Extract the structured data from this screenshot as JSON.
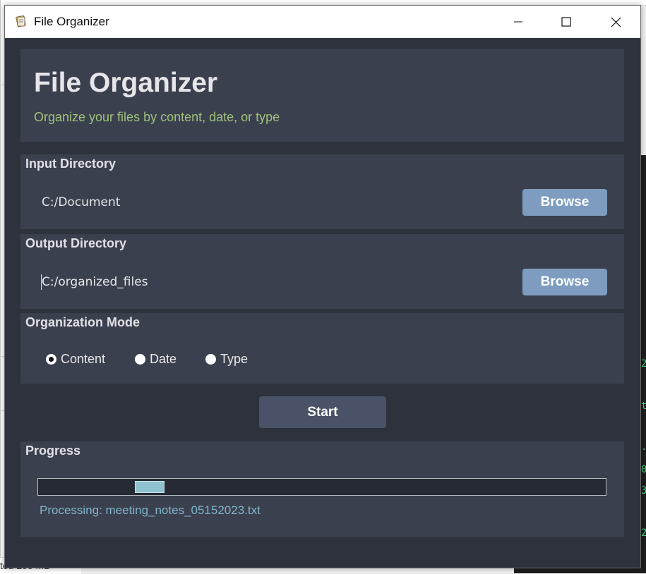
{
  "window": {
    "title": "File Organizer",
    "icons": {
      "app": "file-organizer-app-icon",
      "minimize": "minimize-icon",
      "maximize": "maximize-icon",
      "close": "close-icon"
    }
  },
  "header": {
    "title": "File Organizer",
    "subtitle": "Organize your files by content, date, or type"
  },
  "input_directory": {
    "label": "Input Directory",
    "value": "C:/Document",
    "browse_label": "Browse"
  },
  "output_directory": {
    "label": "Output Directory",
    "value": "C:/organized_files",
    "browse_label": "Browse"
  },
  "organization_mode": {
    "label": "Organization Mode",
    "options": [
      {
        "label": "Content",
        "selected": true
      },
      {
        "label": "Date",
        "selected": false
      },
      {
        "label": "Type",
        "selected": false
      }
    ]
  },
  "start_label": "Start",
  "progress": {
    "label": "Progress",
    "status": "Processing: meeting_notes_05152023.txt",
    "indicator_position": 0.18
  },
  "background": {
    "status_text": "ted  298 MB",
    "terminal_lines": [
      "2",
      "t",
      ".",
      "0",
      "3",
      "2"
    ]
  },
  "colors": {
    "window_bg": "#2d323d",
    "panel_bg": "#3b404e",
    "subtitle": "#9ec27a",
    "browse_button": "#7e9cbf",
    "start_button": "#4a5267",
    "progress_fill": "#8fc1cf",
    "status_text": "#7fb4c9"
  }
}
